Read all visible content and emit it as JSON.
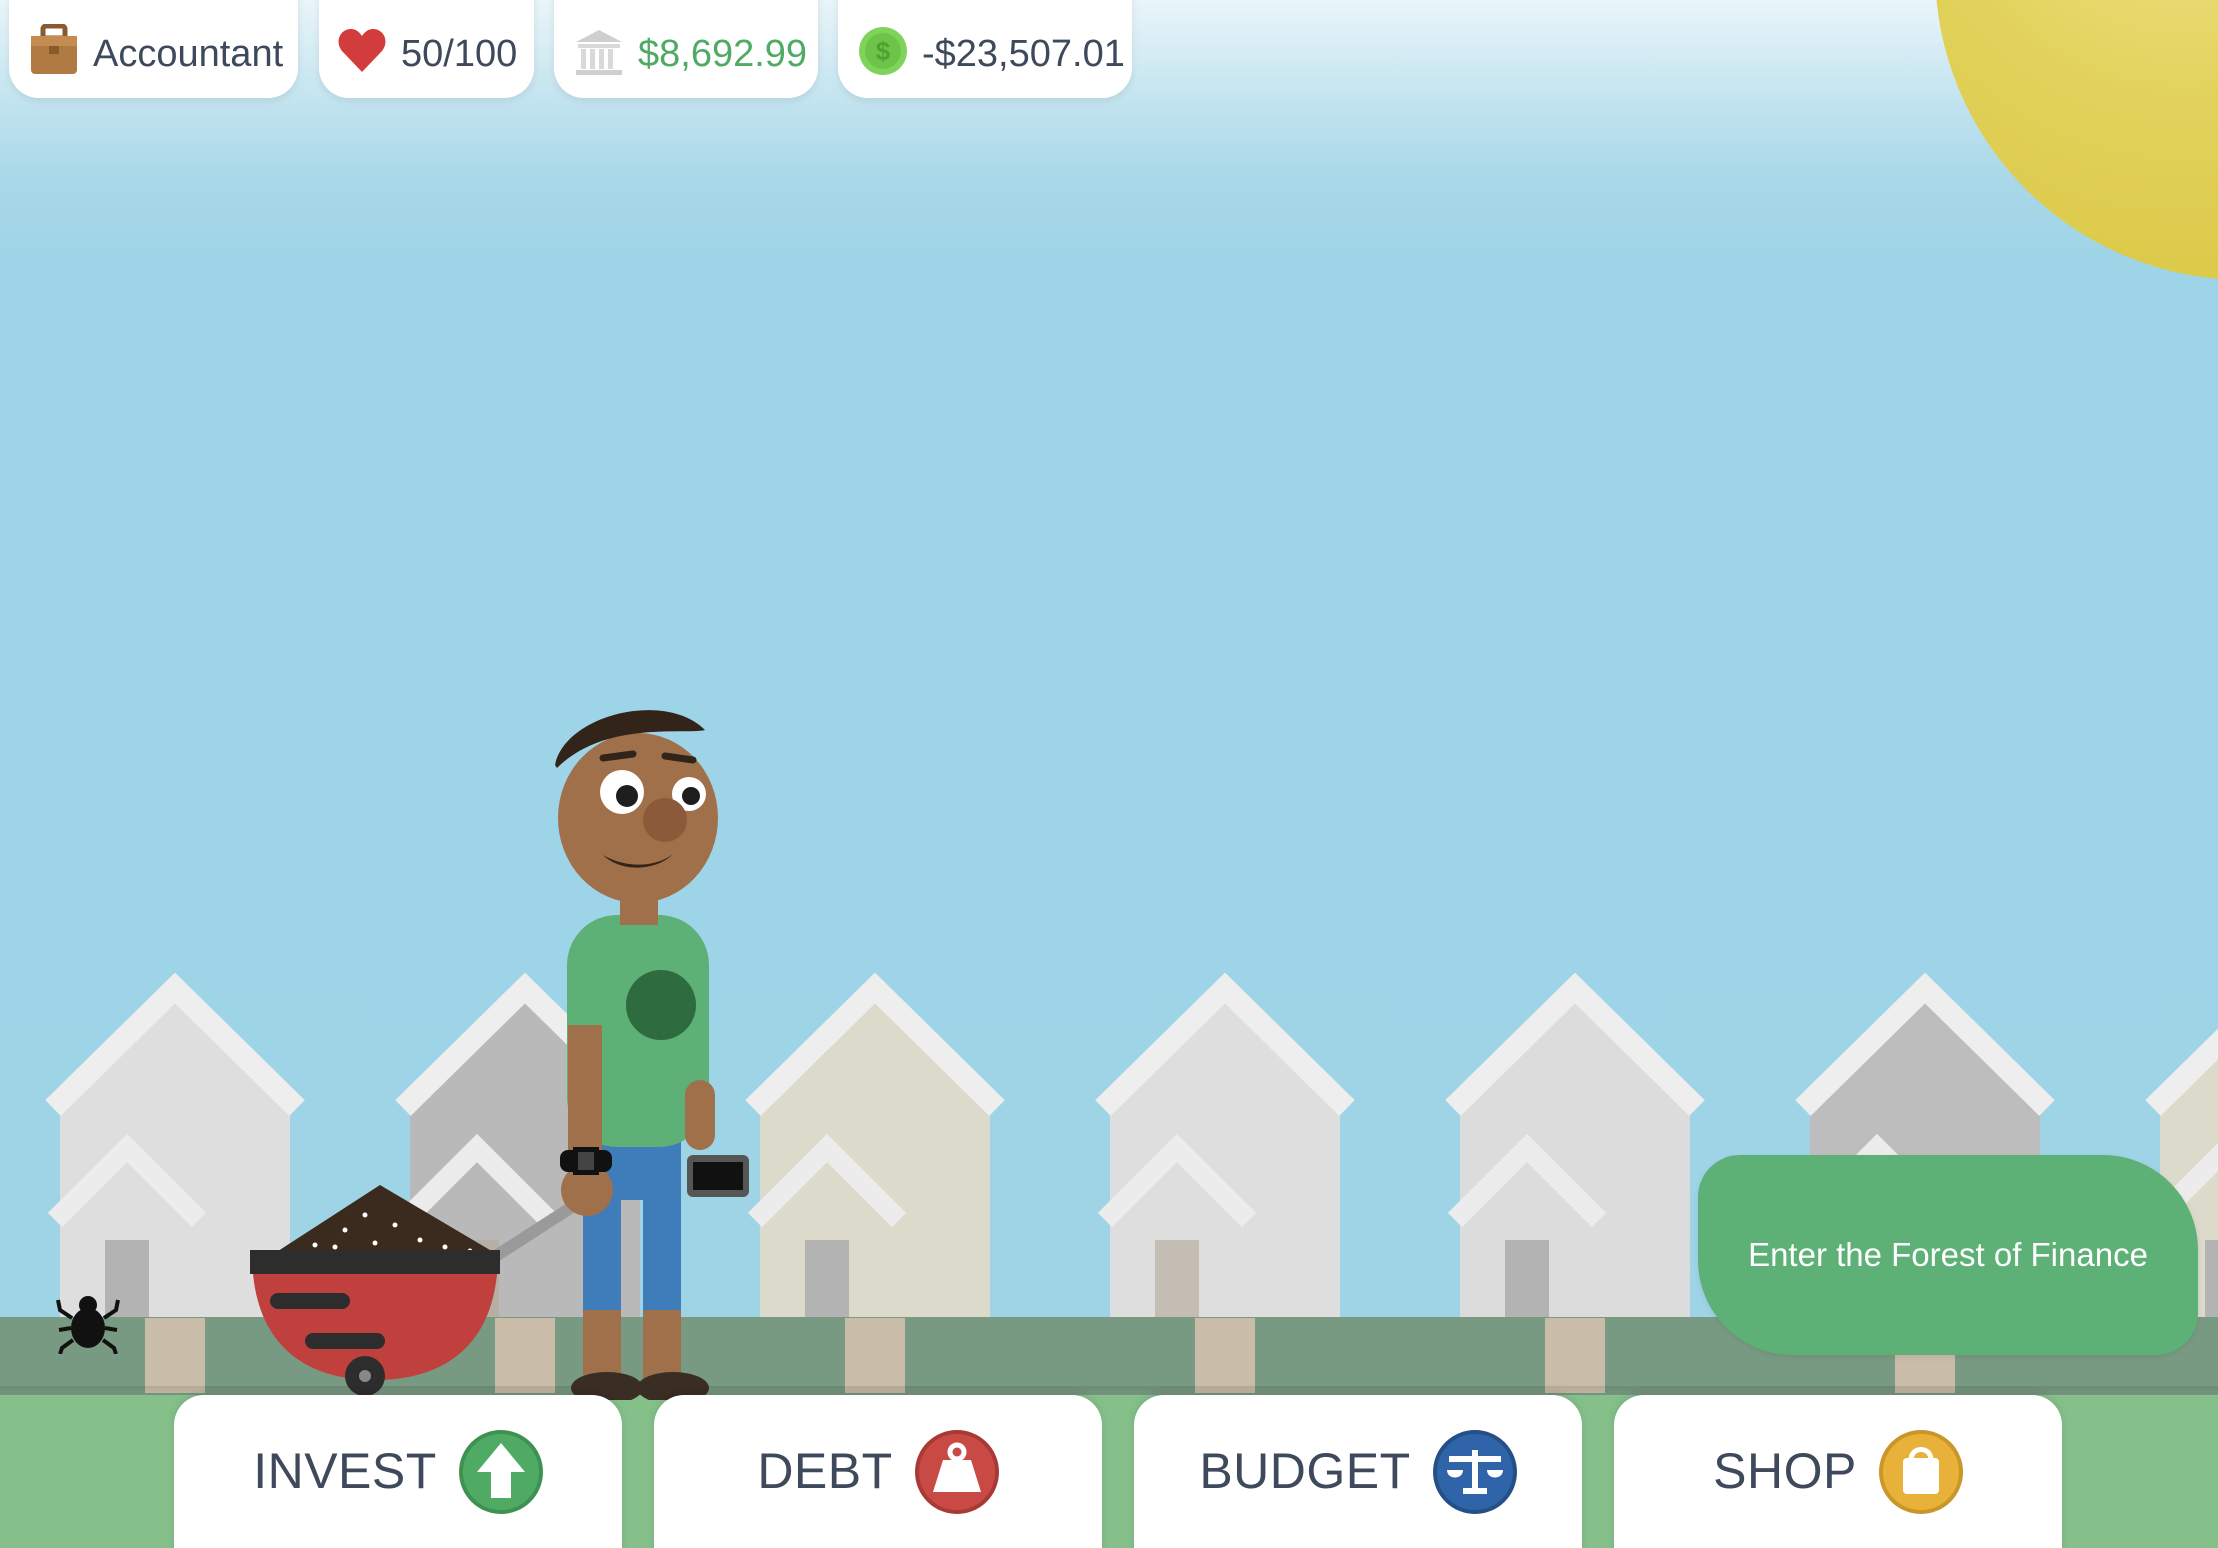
{
  "hud": {
    "job": "Accountant",
    "health": "50/100",
    "bank_balance": "$8,692.99",
    "cash_balance": "-$23,507.01"
  },
  "icons": {
    "job": "briefcase-icon",
    "health": "heart-icon",
    "bank": "bank-icon",
    "cash": "coin-icon",
    "invest": "arrow-up-icon",
    "debt": "weight-icon",
    "budget": "scale-icon",
    "shop": "shopping-bag-icon"
  },
  "colors": {
    "sky": "#9fd4e7",
    "sun": "#e2d25c",
    "positive": "#4fab64",
    "text": "#3e4a5b",
    "forest_button": "#5db176",
    "invest": "#4fab64",
    "debt": "#c94a45",
    "budget": "#2f64a8",
    "shop": "#e8b23a"
  },
  "forest_button": {
    "label": "Enter the Forest of Finance"
  },
  "nav": {
    "invest": "INVEST",
    "debt": "DEBT",
    "budget": "BUDGET",
    "shop": "SHOP"
  }
}
